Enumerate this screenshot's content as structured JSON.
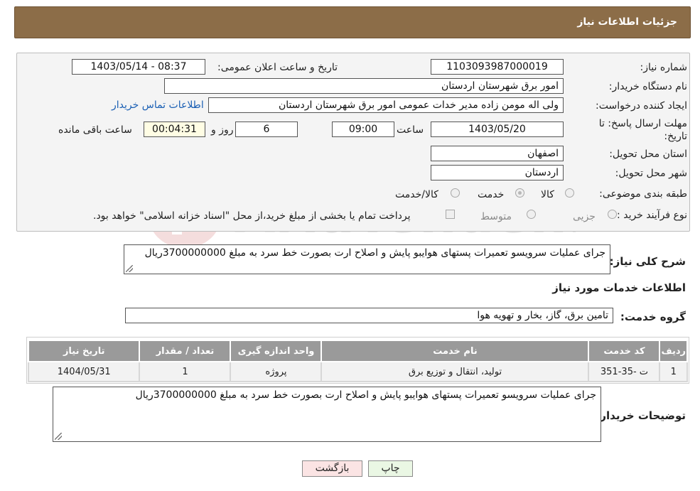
{
  "header": {
    "title": "جزئیات اطلاعات نیاز"
  },
  "form": {
    "need_number": {
      "label": "شماره نیاز:",
      "value": "1103093987000019"
    },
    "announce_datetime": {
      "label": "تاریخ و ساعت اعلان عمومی:",
      "value": "1403/05/14 - 08:37"
    },
    "buyer_org": {
      "label": "نام دستگاه خریدار:",
      "value": "امور برق شهرستان اردستان"
    },
    "requester": {
      "label": "ایجاد کننده درخواست:",
      "value": "ولی اله مومن زاده مدیر خدات عمومی امور برق شهرستان اردستان",
      "contact_link": "اطلاعات تماس خریدار"
    },
    "deadline": {
      "label_line1": "مهلت ارسال پاسخ: تا",
      "label_line2": "تاریخ:",
      "date": "1403/05/20",
      "time_label": "ساعت",
      "time": "09:00",
      "days": "6",
      "days_label": "روز و",
      "remaining": "00:04:31",
      "remaining_label": "ساعت باقی مانده"
    },
    "province": {
      "label": "استان محل تحویل:",
      "value": "اصفهان"
    },
    "city": {
      "label": "شهر محل تحویل:",
      "value": "اردستان"
    },
    "category": {
      "label": "طبقه بندی موضوعی:",
      "options": [
        "کالا",
        "خدمت",
        "کالا/خدمت"
      ],
      "selected": "خدمت"
    },
    "process": {
      "label": "نوع فرآیند خرید :",
      "options": [
        "جزیی",
        "متوسط"
      ],
      "payment_note": "پرداخت تمام یا بخشی از مبلغ خرید،از محل \"اسناد خزانه اسلامی\" خواهد بود."
    }
  },
  "summary": {
    "label": "شرح کلی نیاز:",
    "text": "جرای عملیات سرویسو تعمیرات پستهای هوایبو پایش و اصلاح ارت بصورت خط سرد به مبلغ 3700000000ریال"
  },
  "services_title": "اطلاعات خدمات مورد نیاز",
  "service_group": {
    "label": "گروه خدمت:",
    "value": "تامین برق، گاز، بخار و تهویه هوا"
  },
  "table": {
    "headers": [
      "ردیف",
      "کد خدمت",
      "نام خدمت",
      "واحد اندازه گیری",
      "تعداد / مقدار",
      "تاریخ نیاز"
    ],
    "rows": [
      [
        "1",
        "ت -35-351",
        "تولید، انتقال و توزیع برق",
        "پروژه",
        "1",
        "1404/05/31"
      ]
    ]
  },
  "buyer_notes": {
    "label": "توضیحات خریدار:",
    "text": "جرای عملیات سرویسو تعمیرات پستهای هوایبو پایش و اصلاح ارت بصورت خط سرد به مبلغ 3700000000ریال"
  },
  "buttons": {
    "print": "چاپ",
    "back": "بازگشت"
  },
  "watermark": {
    "text": "AriaTender.neT"
  },
  "colors": {
    "header_bg": "#8c6d48",
    "table_header_bg": "#9a9a9a",
    "link": "#1a5fb4"
  }
}
